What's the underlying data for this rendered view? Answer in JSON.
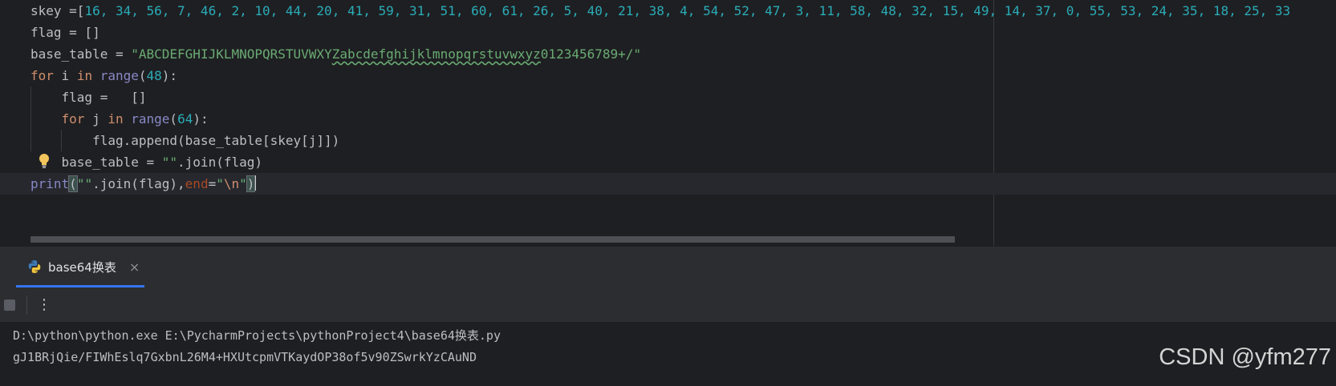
{
  "editor": {
    "line1": {
      "prefix": "skey =[",
      "values": "16, 34, 56, 7, 46, 2, 10, 44, 20, 41, 59, 31, 51, 60, 61, 26, 5, 40, 21, 38, 4, 54, 52, 47, 3, 11, 58, 48, 32, 15, 49, 14, 37, 0, 55, 53, 24, 35, 18, 25, 33"
    },
    "line2": "flag = []",
    "line3": {
      "prefix": "base_table = ",
      "q1": "\"",
      "str_a": "ABCDEFGHIJKLMNOPQRSTUVWXY",
      "str_b": "Zabcdefghijklmnopqrstuvwxyz",
      "str_c": "0123456789+/",
      "q2": "\""
    },
    "line4": {
      "kw_for": "for",
      "var": " i ",
      "kw_in": "in",
      "sp": " ",
      "fn": "range",
      "open": "(",
      "num": "48",
      "close": "):"
    },
    "line5": "    flag =   []",
    "line6": {
      "indent": "    ",
      "kw_for": "for",
      "var": " j ",
      "kw_in": "in",
      "sp": " ",
      "fn": "range",
      "open": "(",
      "num": "64",
      "close": "):"
    },
    "line7": "        flag.append(base_table[skey[j]])",
    "line8": {
      "prefix": "    base_table = ",
      "str": "\"\"",
      "suffix": ".join(flag)"
    },
    "line9": {
      "fn": "print",
      "open": "(",
      "str": "\"\"",
      "mid": ".join(flag),",
      "kwarg": "end",
      "eq": "=",
      "q1": "\"",
      "esc": "\\n",
      "q2": "\"",
      "close": ")"
    }
  },
  "run_tab": {
    "label": "base64换表",
    "close": "×",
    "icon": "python-icon"
  },
  "toolbar": {
    "more": "⋮"
  },
  "console": {
    "lines": [
      "D:\\python\\python.exe E:\\PycharmProjects\\pythonProject4\\base64换表.py",
      "gJ1BRjQie/FIWhEslq7GxbnL26M4+HXUtcpmVTKaydOP38of5v90ZSwrkYzCAuND"
    ]
  },
  "watermark": "CSDN @yfm277",
  "colors": {
    "background": "#1e1f22",
    "keyword": "#cf8e6d",
    "number": "#2aacb8",
    "string": "#6aab73",
    "builtin": "#8888c6",
    "kwarg": "#aa4926",
    "tab_accent": "#3574f0"
  }
}
